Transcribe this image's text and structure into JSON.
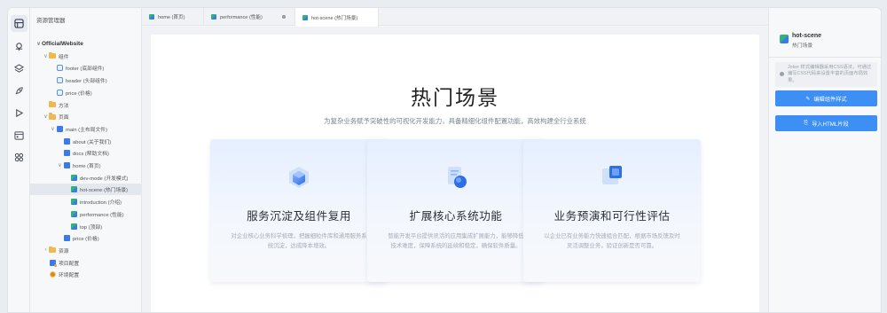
{
  "explorer": {
    "title": "资源管理器",
    "tree": [
      {
        "label": "OfficialWebsite",
        "depth": 0,
        "chev": "∨",
        "icon": "none",
        "root": true
      },
      {
        "label": "组件",
        "depth": 1,
        "chev": "∨",
        "icon": "folder"
      },
      {
        "label": "footer (底部组件)",
        "depth": 2,
        "chev": "",
        "icon": "component"
      },
      {
        "label": "header (头部组件)",
        "depth": 2,
        "chev": "",
        "icon": "component"
      },
      {
        "label": "price (价格)",
        "depth": 2,
        "chev": "",
        "icon": "component"
      },
      {
        "label": "方法",
        "depth": 1,
        "chev": "",
        "icon": "folder"
      },
      {
        "label": "页面",
        "depth": 1,
        "chev": "∨",
        "icon": "folder"
      },
      {
        "label": "main (主布局文件)",
        "depth": 2,
        "chev": "∨",
        "icon": "page"
      },
      {
        "label": "about (关于我们)",
        "depth": 3,
        "chev": "",
        "icon": "page"
      },
      {
        "label": "docs (帮助文档)",
        "depth": 3,
        "chev": "",
        "icon": "page"
      },
      {
        "label": "home (首页)",
        "depth": 3,
        "chev": "∨",
        "icon": "page"
      },
      {
        "label": "dev-mode (开发模式)",
        "depth": 4,
        "chev": "",
        "icon": "green"
      },
      {
        "label": "hot-scene (热门场景)",
        "depth": 4,
        "chev": "",
        "icon": "green",
        "selected": true
      },
      {
        "label": "introduction (介绍)",
        "depth": 4,
        "chev": "",
        "icon": "green"
      },
      {
        "label": "performance (性能)",
        "depth": 4,
        "chev": "",
        "icon": "green"
      },
      {
        "label": "top (顶部)",
        "depth": 4,
        "chev": "",
        "icon": "green"
      },
      {
        "label": "price (价格)",
        "depth": 3,
        "chev": "",
        "icon": "page"
      },
      {
        "label": "资源",
        "depth": 1,
        "chev": "›",
        "icon": "folder"
      },
      {
        "label": "项目配置",
        "depth": 1,
        "chev": "",
        "icon": "config"
      },
      {
        "label": "环境配置",
        "depth": 1,
        "chev": "",
        "icon": "gear"
      }
    ]
  },
  "tabs": [
    {
      "label": "home (首页)",
      "active": false,
      "dirty": false
    },
    {
      "label": "performance (性能)",
      "active": false,
      "dirty": true
    },
    {
      "label": "hot-scene (热门场景)",
      "active": true,
      "dirty": false
    }
  ],
  "page": {
    "title": "热门场景",
    "subtitle": "为复杂业务赋予突破性的可视化开发能力，具备精细化组件配置功能，高效构建全行业系统",
    "cards": [
      {
        "title": "服务沉淀及组件复用",
        "desc": "对企业核心业务科学梳理，把握细粒件库和通用服务系统沉淀，达成降本增效。"
      },
      {
        "title": "扩展核心系统功能",
        "desc": "智能开发平台提供灵活的应用集成扩展能力，能够降低技术难度，保障系统的延续和稳定，确保软件质量。"
      },
      {
        "title": "业务预演和可行性评估",
        "desc": "以企业已有业务能力快速组合匹配，根据市场反馈及时灵活调整业务，验证创新是否可靠。"
      }
    ]
  },
  "panel": {
    "title": "hot-scene",
    "subtitle": "热门场景",
    "note": "Joker 样式编辑器采用CSS语法，可通过编写CSS代码来设置丰富的页面布局效果。",
    "btn_edit": "编辑组件样式",
    "btn_import": "导入HTML片段"
  },
  "colors": {
    "accent": "#3d8ef5",
    "folder": "#f2b94a"
  }
}
